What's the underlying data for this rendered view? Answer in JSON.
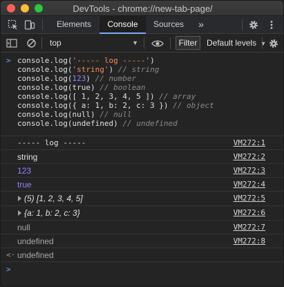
{
  "window": {
    "title": "DevTools - chrome://new-tab-page/"
  },
  "tabs": [
    {
      "label": "Elements"
    },
    {
      "label": "Console"
    },
    {
      "label": "Sources"
    }
  ],
  "tabs_more": "»",
  "toolbar": {
    "context": "top",
    "filter_label": "Filter",
    "levels_label": "Default levels"
  },
  "command": {
    "prompt": ">",
    "lines": [
      {
        "code": "console.log(",
        "str": "'----- log -----'",
        "tail": ")",
        "comment": ""
      },
      {
        "code": "console.log(",
        "str": "'string'",
        "tail": ")",
        "comment": " // string"
      },
      {
        "code": "console.log(",
        "num": "123",
        "tail": ")",
        "comment": " // number"
      },
      {
        "code": "console.log(true)",
        "comment": " // boolean"
      },
      {
        "code": "console.log([ 1, 2, 3, 4, 5 ])",
        "comment": " // array"
      },
      {
        "code": "console.log({ a: 1, b: 2, c: 3 })",
        "comment": " // object"
      },
      {
        "code": "console.log(null)",
        "comment": " // null"
      },
      {
        "code": "console.log(undefined)",
        "comment": " // undefined"
      }
    ]
  },
  "output": [
    {
      "text": "----- log -----",
      "source": "VM272:1"
    },
    {
      "text": "string",
      "source": "VM272:2"
    },
    {
      "text": "123",
      "source": "VM272:3"
    },
    {
      "text": "true",
      "source": "VM272:4"
    },
    {
      "text": "(5) [1, 2, 3, 4, 5]",
      "source": "VM272:5"
    },
    {
      "text": "{a: 1, b: 2, c: 3}",
      "source": "VM272:6"
    },
    {
      "text": "null",
      "source": "VM272:7"
    },
    {
      "text": "undefined",
      "source": "VM272:8"
    }
  ],
  "return_value": {
    "marker": "<·",
    "text": "undefined"
  },
  "input_prompt": ">",
  "colors": {
    "string": "#f28b54",
    "number": "#9980ff",
    "boolean": "#9980ff",
    "comment": "#8a8a8a",
    "prompt": "#7aa6e8",
    "active_tab_underline": "#7cacf8"
  },
  "icons": [
    "inspect-icon",
    "device-toolbar-icon",
    "sidebar-toggle-icon",
    "clear-console-icon",
    "eye-icon",
    "settings-gear-icon",
    "more-menu-icon",
    "console-settings-gear-icon"
  ]
}
